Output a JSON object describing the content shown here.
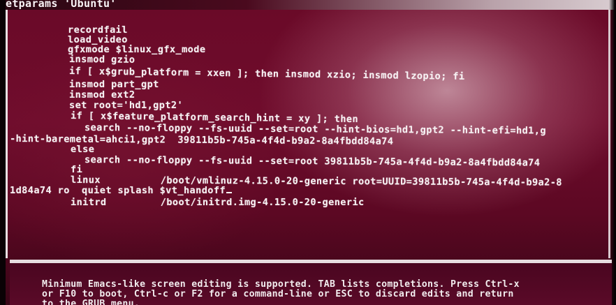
{
  "editor": {
    "title": "etparams 'Ubuntu'",
    "lines": [
      "recordfail",
      "load_video",
      "gfxmode $linux_gfx_mode",
      "insmod gzio",
      "if [ x$grub_platform = xxen ]; then insmod xzio; insmod lzopio; fi",
      "insmod part_gpt",
      "insmod ext2",
      "set root='hd1,gpt2'",
      "if [ x$feature_platform_search_hint = xy ]; then",
      "search --no-floppy --fs-uuid --set=root --hint-bios=hd1,gpt2 --hint-efi=hd1,g",
      "-hint-baremetal=ahci1,gpt2  39811b5b-745a-4f4d-b9a2-8a4fbdd84a74",
      "else",
      "search --no-floppy --fs-uuid --set=root 39811b5b-745a-4f4d-b9a2-8a4fbdd84a74",
      "fi",
      "linux          /boot/vmlinuz-4.15.0-20-generic root=UUID=39811b5b-745a-4f4d-b9a2-8",
      "1d84a74 ro  quiet splash $vt_handoff",
      "initrd         /boot/initrd.img-4.15.0-20-generic"
    ]
  },
  "help": {
    "line1": "Minimum Emacs-like screen editing is supported. TAB lists completions. Press Ctrl-x",
    "line2": "or F10 to boot, Ctrl-c or F2 for a command-line or ESC to discard edits and return",
    "line3": "to the GRUB menu."
  }
}
